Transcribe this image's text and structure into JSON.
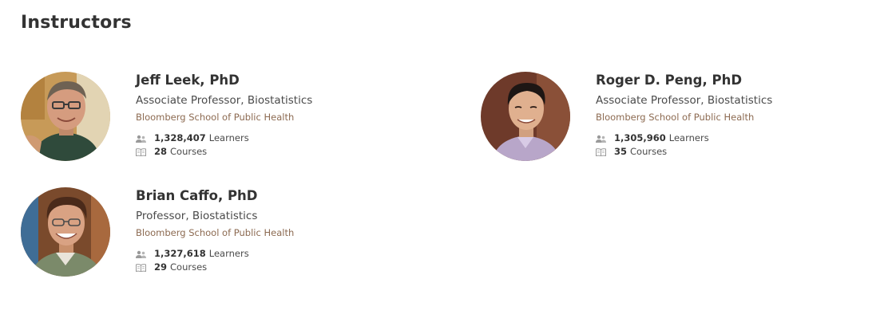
{
  "section": {
    "title": "Instructors"
  },
  "instructors": [
    {
      "name": "Jeff Leek, PhD",
      "title": "Associate Professor, Biostatistics",
      "organization": "Bloomberg School of Public Health",
      "learners_count": "1,328,407",
      "learners_label": "Learners",
      "courses_count": "28",
      "courses_label": "Courses"
    },
    {
      "name": "Roger D. Peng, PhD",
      "title": "Associate Professor, Biostatistics",
      "organization": "Bloomberg School of Public Health",
      "learners_count": "1,305,960",
      "learners_label": "Learners",
      "courses_count": "35",
      "courses_label": "Courses"
    },
    {
      "name": "Brian Caffo, PhD",
      "title": "Professor, Biostatistics",
      "organization": "Bloomberg School of Public Health",
      "learners_count": "1,327,618",
      "learners_label": "Learners",
      "courses_count": "29",
      "courses_label": "Courses"
    }
  ],
  "icons": {
    "learners": "users-icon",
    "courses": "book-icon"
  },
  "colors": {
    "organization_link": "#8c6a51",
    "icon": "#9a9a9a"
  }
}
